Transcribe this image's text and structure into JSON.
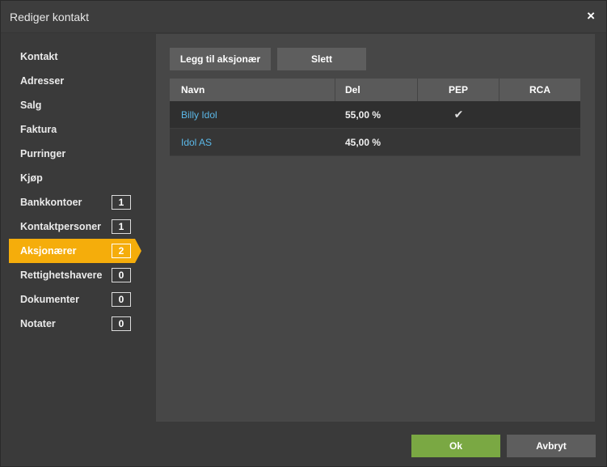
{
  "dialog": {
    "title": "Rediger kontakt",
    "close_glyph": "×"
  },
  "sidebar": {
    "items": [
      {
        "label": "Kontakt",
        "badge": null,
        "active": false
      },
      {
        "label": "Adresser",
        "badge": null,
        "active": false
      },
      {
        "label": "Salg",
        "badge": null,
        "active": false
      },
      {
        "label": "Faktura",
        "badge": null,
        "active": false
      },
      {
        "label": "Purringer",
        "badge": null,
        "active": false
      },
      {
        "label": "Kjøp",
        "badge": null,
        "active": false
      },
      {
        "label": "Bankkontoer",
        "badge": "1",
        "active": false
      },
      {
        "label": "Kontaktpersoner",
        "badge": "1",
        "active": false
      },
      {
        "label": "Aksjonærer",
        "badge": "2",
        "active": true
      },
      {
        "label": "Rettighetshavere",
        "badge": "0",
        "active": false
      },
      {
        "label": "Dokumenter",
        "badge": "0",
        "active": false
      },
      {
        "label": "Notater",
        "badge": "0",
        "active": false
      }
    ]
  },
  "toolbar": {
    "add_label": "Legg til aksjonær",
    "delete_label": "Slett"
  },
  "table": {
    "columns": [
      "Navn",
      "Del",
      "PEP",
      "RCA"
    ],
    "rows": [
      {
        "name": "Billy Idol",
        "del": "55,00 %",
        "pep": "✔",
        "rca": ""
      },
      {
        "name": "Idol AS",
        "del": "45,00 %",
        "pep": "",
        "rca": ""
      }
    ]
  },
  "footer": {
    "ok_label": "Ok",
    "cancel_label": "Avbryt"
  },
  "colors": {
    "accent": "#f5ad0b",
    "ok": "#7aa843",
    "link": "#5bb8e8"
  }
}
